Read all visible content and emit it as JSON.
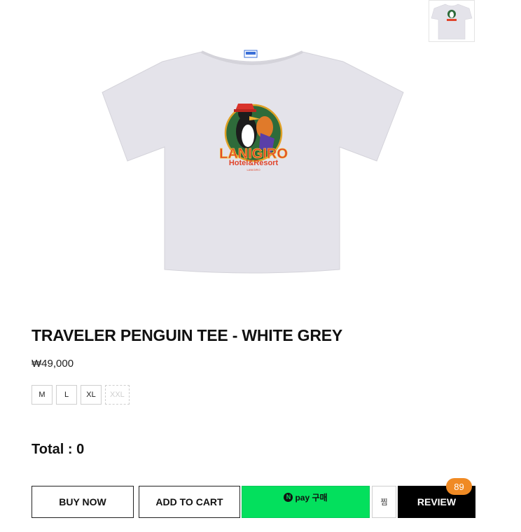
{
  "product": {
    "title": "TRAVELER PENGUIN TEE - WHITE GREY",
    "price": "₩49,000",
    "image_logo_top": "LANIGIRO",
    "image_logo_bottom": "Hotel&Resort",
    "image_tag": "LANIGIRO"
  },
  "sizes": [
    {
      "label": "M",
      "available": true
    },
    {
      "label": "L",
      "available": true
    },
    {
      "label": "XL",
      "available": true
    },
    {
      "label": "XXL",
      "available": false
    }
  ],
  "total": {
    "label": "Total : 0"
  },
  "actions": {
    "buy_now": "BUY NOW",
    "add_to_cart": "ADD TO CART",
    "npay_mark": "N",
    "npay_label": "pay 구매",
    "wish": "찜",
    "review": "REVIEW",
    "review_count": "89"
  },
  "colors": {
    "npay_green": "#03e05d",
    "review_badge": "#f08a24",
    "shirt": "#e4e3ea"
  }
}
